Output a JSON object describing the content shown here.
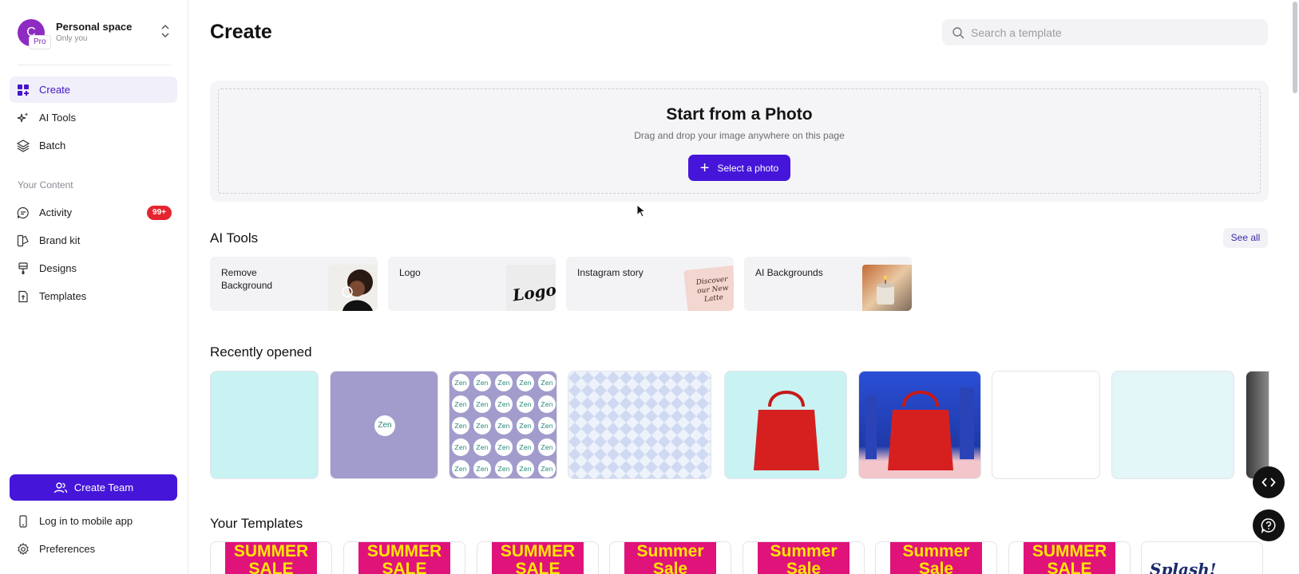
{
  "workspace": {
    "avatar_letter": "C",
    "badge": "Pro",
    "title": "Personal space",
    "subtitle": "Only you"
  },
  "sidebar": {
    "primary": [
      {
        "label": "Create",
        "icon": "grid-plus-icon",
        "active": true
      },
      {
        "label": "AI Tools",
        "icon": "sparkles-icon",
        "active": false
      },
      {
        "label": "Batch",
        "icon": "layers-icon",
        "active": false
      }
    ],
    "section_label": "Your Content",
    "content": [
      {
        "label": "Activity",
        "icon": "chat-icon",
        "badge": "99+"
      },
      {
        "label": "Brand kit",
        "icon": "brand-kit-icon"
      },
      {
        "label": "Designs",
        "icon": "brush-icon"
      },
      {
        "label": "Templates",
        "icon": "template-icon"
      }
    ],
    "create_team": "Create Team",
    "mobile": "Log in to mobile app",
    "preferences": "Preferences"
  },
  "header": {
    "title": "Create",
    "search_placeholder": "Search a template"
  },
  "photo": {
    "title": "Start from a Photo",
    "subtitle": "Drag and drop your image anywhere on this page",
    "button": "Select a photo"
  },
  "ai_tools": {
    "title": "AI Tools",
    "see_all": "See all",
    "cards": [
      {
        "label": "Remove Background",
        "thumb_icon": "portrait-photo-icon"
      },
      {
        "label": "Logo",
        "thumb_text": "Logos"
      },
      {
        "label": "Instagram story",
        "thumb_text": "Discover our New Latte"
      },
      {
        "label": "AI Backgrounds",
        "thumb_icon": "candle-photo-icon"
      }
    ]
  },
  "recent": {
    "title": "Recently opened",
    "cards": [
      {
        "kind": "plain",
        "color": "#c9f2f2"
      },
      {
        "kind": "logo",
        "color": "#a29ccc",
        "logo_text": "Zen"
      },
      {
        "kind": "pattern",
        "color": "#a29ccc",
        "logo_text": "Zen"
      },
      {
        "kind": "checker",
        "color": "#dbe4f6"
      },
      {
        "kind": "bag",
        "color": "#c9f2f2"
      },
      {
        "kind": "bag-city",
        "color": "#2b4fd6"
      },
      {
        "kind": "plain",
        "color": "#ffffff"
      },
      {
        "kind": "plain",
        "color": "#e3f6f8"
      },
      {
        "kind": "dark",
        "color": "#3a3a3a"
      }
    ]
  },
  "templates": {
    "title": "Your Templates",
    "cards": [
      {
        "text": "SUMMER SALE"
      },
      {
        "text": "SUMMER SALE"
      },
      {
        "text": "SUMMER SALE"
      },
      {
        "text": "Summer Sale"
      },
      {
        "text": "Summer Sale"
      },
      {
        "text": "Summer Sale"
      },
      {
        "text": "SUMMER SALE"
      },
      {
        "text": "Splash!"
      }
    ]
  },
  "fabs": {
    "code": "code-icon",
    "help": "help-icon"
  }
}
